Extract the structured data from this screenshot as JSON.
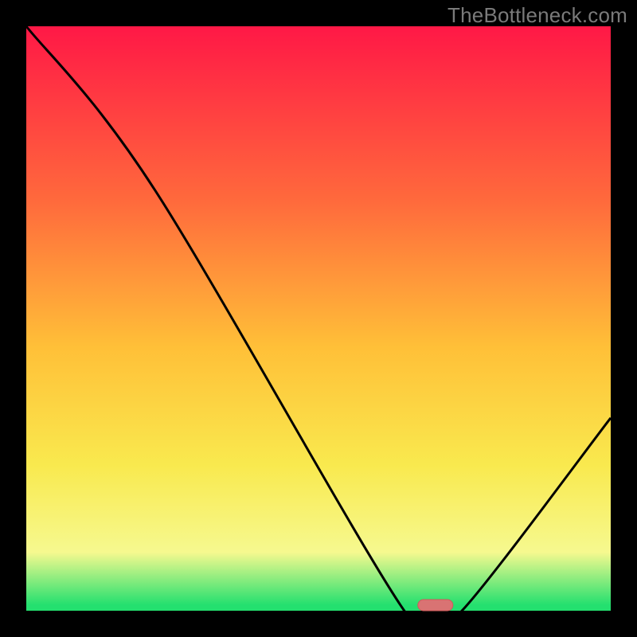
{
  "watermark": "TheBottleneck.com",
  "colors": {
    "frame": "#000000",
    "curve": "#000000",
    "marker_fill": "#d97373",
    "marker_stroke": "#cf5a5a",
    "grad_top": "#ff1846",
    "grad_mid1": "#ff6a3c",
    "grad_mid2": "#ffc038",
    "grad_mid3": "#f9e94e",
    "grad_band": "#f6f98f",
    "grad_bottom": "#24e06f"
  },
  "chart_data": {
    "type": "line",
    "title": "",
    "xlabel": "",
    "ylabel": "",
    "xlim": [
      0,
      100
    ],
    "ylim": [
      0,
      100
    ],
    "series": [
      {
        "name": "bottleneck-curve",
        "x": [
          0,
          22,
          64,
          70,
          75,
          100
        ],
        "values": [
          100,
          72,
          1,
          0,
          0.5,
          33
        ]
      }
    ],
    "optimal_marker": {
      "x": 70,
      "width": 6
    }
  }
}
